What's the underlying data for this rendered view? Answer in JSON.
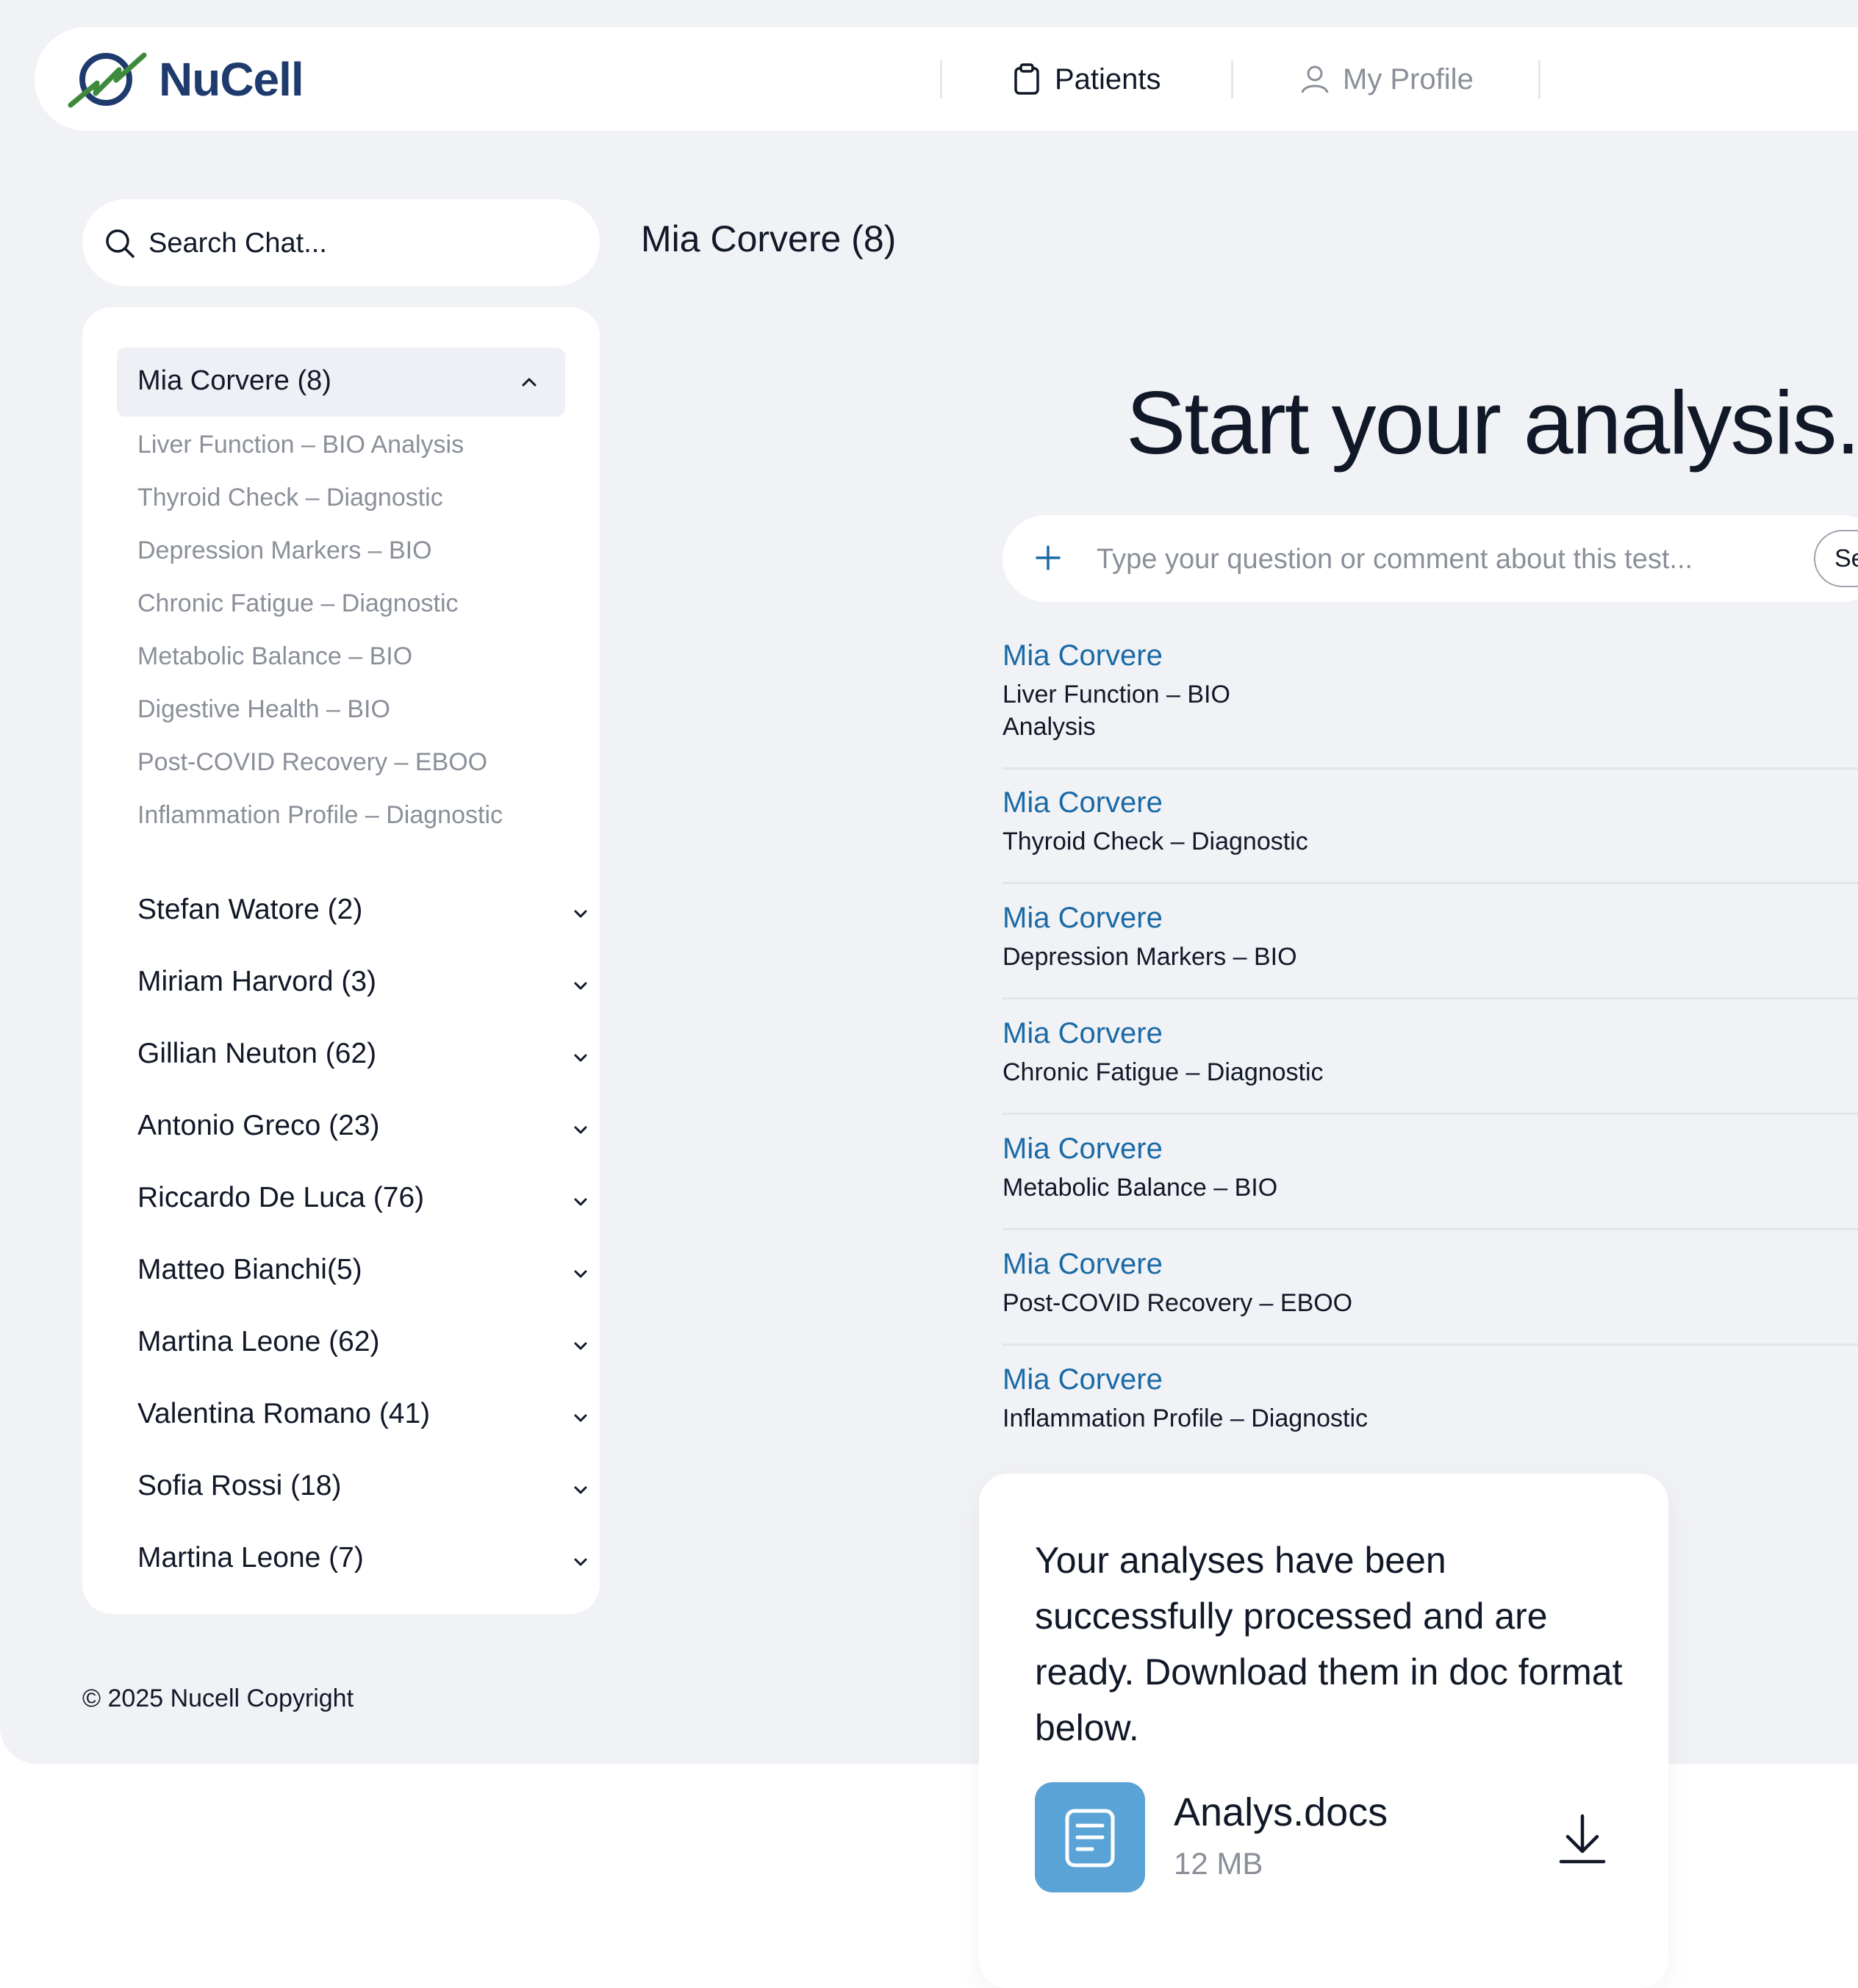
{
  "brand": {
    "name": "NuCell",
    "color": "#1f3b6e",
    "accent": "#3d8a3a"
  },
  "nav": {
    "items": [
      {
        "label": "Patients",
        "icon": "clipboard-icon",
        "active": true
      },
      {
        "label": "My Profile",
        "icon": "user-icon",
        "active": false
      }
    ]
  },
  "search": {
    "placeholder": "Search Chat..."
  },
  "sidebar": {
    "open_group": {
      "label": "Mia Corvere (8)",
      "items": [
        "Liver Function – BIO Analysis",
        "Thyroid Check – Diagnostic",
        "Depression Markers – BIO",
        "Chronic Fatigue – Diagnostic",
        "Metabolic Balance – BIO",
        "Digestive Health – BIO",
        "Post-COVID Recovery – EBOO",
        "Inflammation Profile – Diagnostic"
      ]
    },
    "patients": [
      "Stefan Watore (2)",
      "Miriam Harvord (3)",
      "Gillian Neuton (62)",
      "Antonio Greco (23)",
      "Riccardo De Luca (76)",
      "Matteo Bianchi(5)",
      "Martina Leone (62)",
      "Valentina Romano (41)",
      "Sofia Rossi (18)",
      "Martina Leone (7)"
    ]
  },
  "footer": {
    "copyright": "© 2025 Nucell Copyright"
  },
  "main": {
    "title": "Mia Corvere (8)",
    "hero": "Start your analysis.",
    "composer": {
      "placeholder": "Type your question or comment about this test...",
      "send_label": "Se"
    },
    "results": [
      {
        "name": "Mia Corvere",
        "test": "Liver Function – BIO Analysis"
      },
      {
        "name": "Mia Corvere",
        "test": "Thyroid Check – Diagnostic"
      },
      {
        "name": "Mia Corvere",
        "test": "Depression Markers – BIO"
      },
      {
        "name": "Mia Corvere",
        "test": "Chronic Fatigue – Diagnostic"
      },
      {
        "name": "Mia Corvere",
        "test": "Metabolic Balance – BIO"
      },
      {
        "name": "Mia Corvere",
        "test": "Post-COVID Recovery – EBOO"
      },
      {
        "name": "Mia Corvere",
        "test": "Inflammation Profile – Diagnostic"
      }
    ]
  },
  "popup": {
    "message": "Your analyses have been successfully processed and are ready. Download them in doc format below.",
    "file": {
      "name": "Analys.docs",
      "size": "12 MB",
      "icon": "document-icon",
      "color": "#5aa3d6"
    }
  }
}
